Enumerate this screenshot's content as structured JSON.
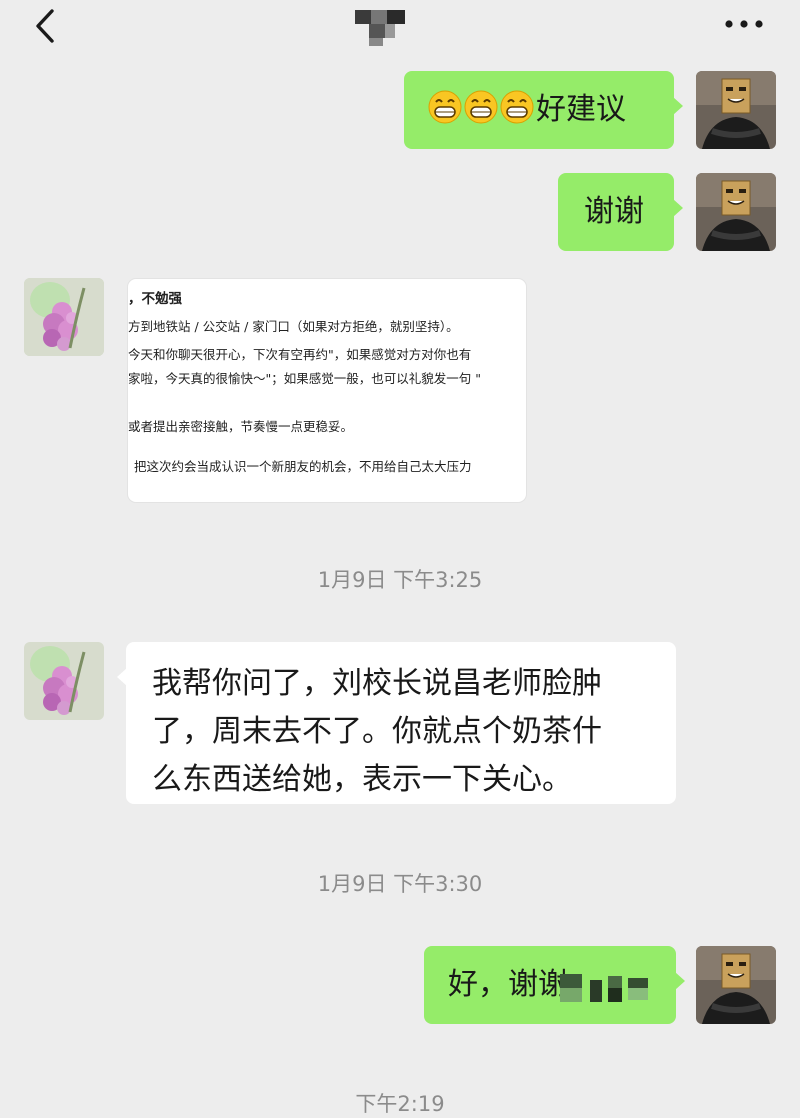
{
  "header": {
    "back_icon": "chevron-left-icon",
    "contact_name_blurred": true,
    "more_icon": "ellipsis-icon"
  },
  "messages": [
    {
      "side": "right",
      "type": "text",
      "emoji": [
        "grin-emoji",
        "grin-emoji",
        "grin-emoji"
      ],
      "text": "好建议"
    },
    {
      "side": "right",
      "type": "text",
      "text": "谢谢"
    },
    {
      "side": "left",
      "type": "image",
      "image_lines": [
        "，不勉强",
        "方到地铁站 / 公交站 / 家门口（如果对方拒绝，就别坚持）。",
        "今天和你聊天很开心，下次有空再约\"，如果感觉对方对你也有",
        "家啦，今天真的很愉快～\"；如果感觉一般，也可以礼貌发一句 \"",
        "或者提出亲密接触，节奏慢一点更稳妥。",
        "把这次约会当成认识一个新朋友的机会，不用给自己太大压力"
      ]
    },
    {
      "side": "center",
      "type": "time",
      "text": "1月9日 下午3:25"
    },
    {
      "side": "left",
      "type": "text",
      "lines": [
        "我帮你问了，刘校长说昌老师脸肿",
        "了，周末去不了。你就点个奶茶什",
        "么东西送给她，表示一下关心。"
      ]
    },
    {
      "side": "center",
      "type": "time",
      "text": "1月9日 下午3:30"
    },
    {
      "side": "right",
      "type": "text",
      "text": "好，谢谢",
      "redacted_tail": true
    },
    {
      "side": "center",
      "type": "time",
      "text": "下午2:19"
    }
  ],
  "colors": {
    "background": "#ededed",
    "sent_bubble": "#95ec69",
    "received_bubble": "#ffffff",
    "timestamp": "#8b8b8b"
  }
}
